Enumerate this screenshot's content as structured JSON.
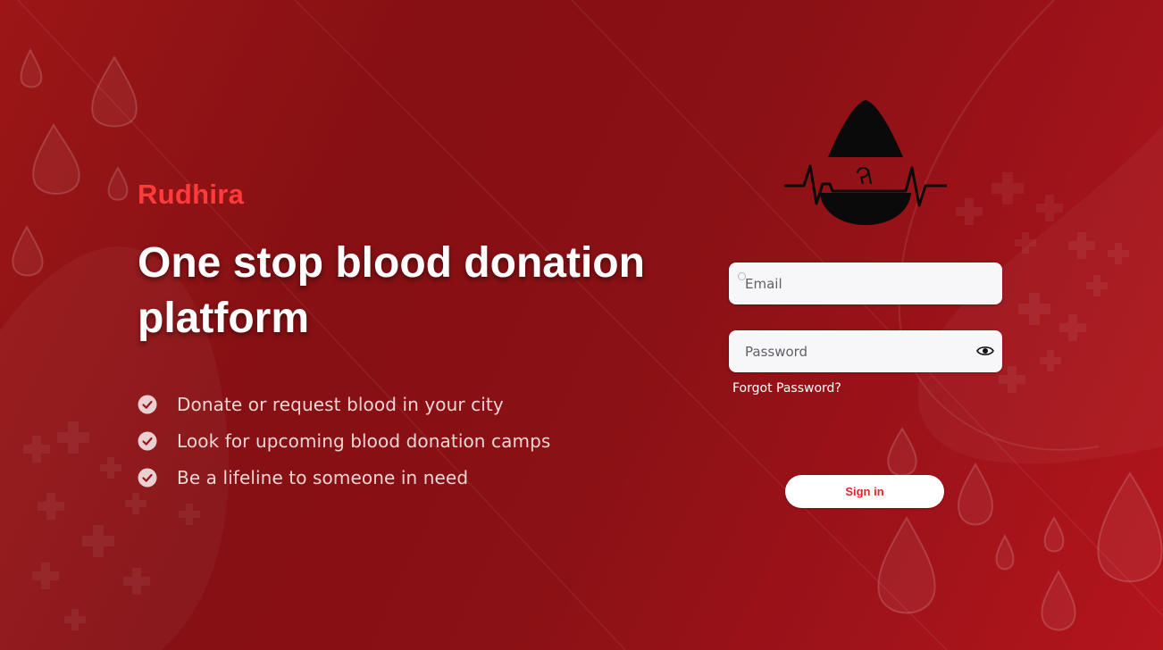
{
  "app": {
    "brand": "Rudhira",
    "headline": "One stop blood donation platform",
    "features": [
      {
        "text": "Donate or request blood in your city",
        "icon": "check-circle-icon"
      },
      {
        "text": "Look for upcoming blood donation camps",
        "icon": "check-circle-icon"
      },
      {
        "text": "Be a lifeline to someone in need",
        "icon": "check-circle-icon"
      }
    ]
  },
  "login": {
    "logo_icon": "blood-drop-heartbeat-icon",
    "email_placeholder": "Email",
    "password_placeholder": "Password",
    "show_password_icon": "eye-icon",
    "forgot_password": "Forgot Password?",
    "sign_in": "Sign in"
  },
  "colors": {
    "background": "#8a1115",
    "brand": "#ff3b3b",
    "sign_in_text": "#e3262d",
    "input_bg": "#f7f7fa"
  }
}
